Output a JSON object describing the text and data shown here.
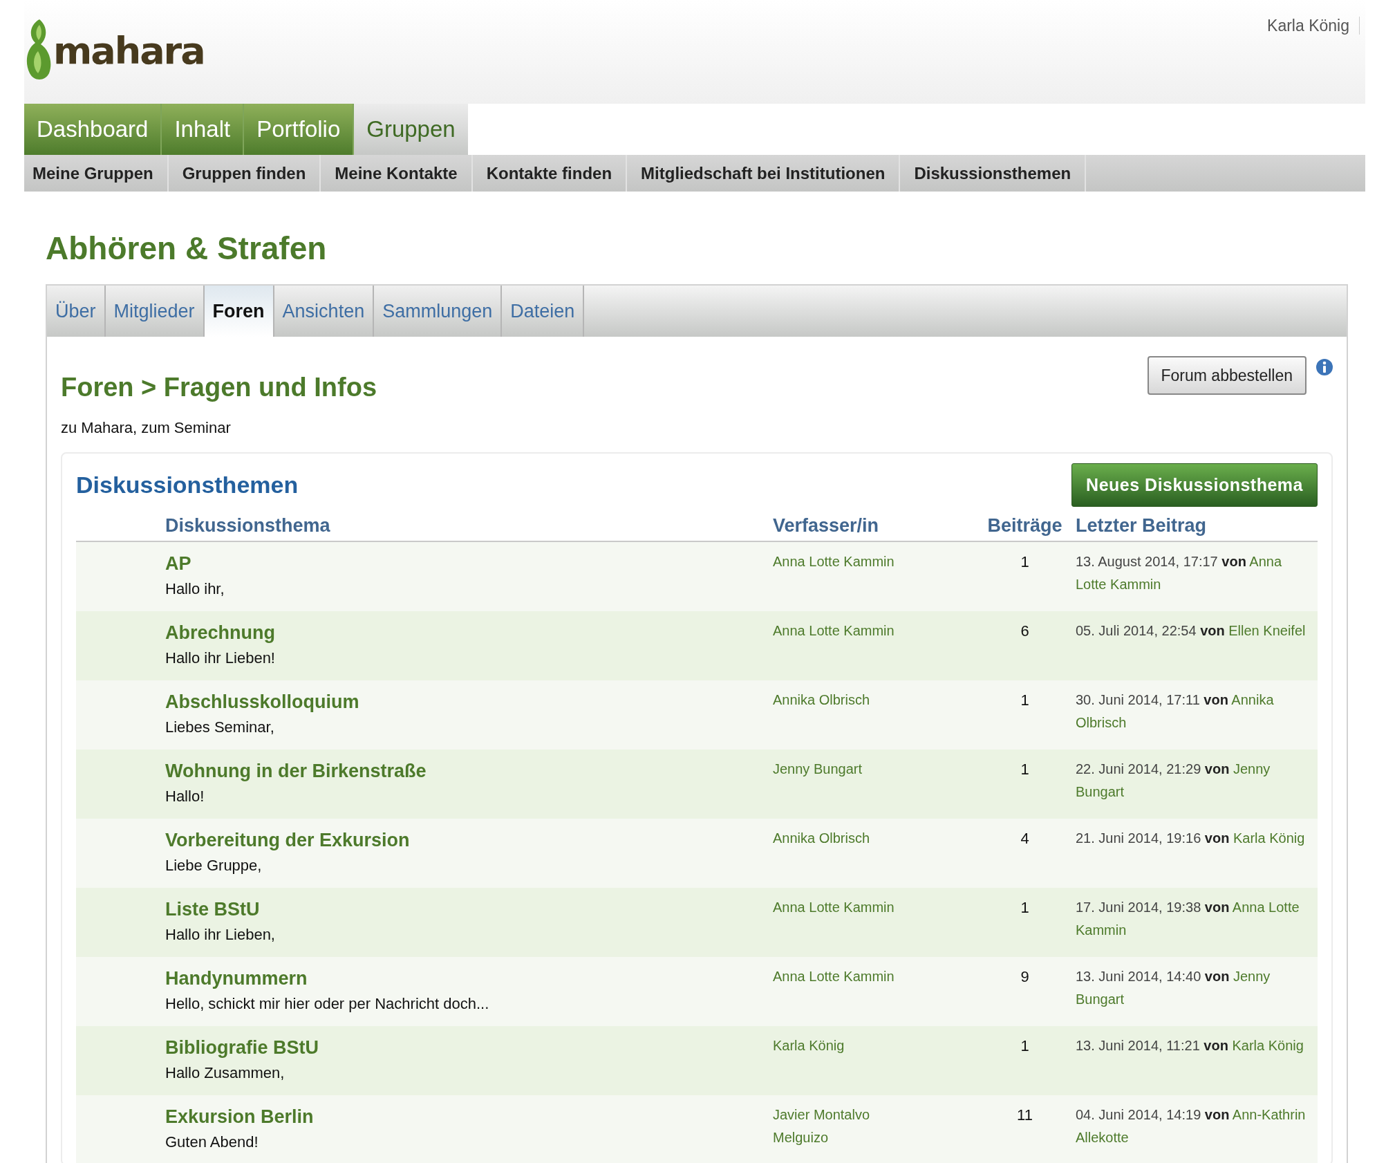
{
  "header": {
    "logo_text": "mahara",
    "user": "Karla König"
  },
  "main_nav": [
    {
      "label": "Dashboard",
      "selected": false
    },
    {
      "label": "Inhalt",
      "selected": false
    },
    {
      "label": "Portfolio",
      "selected": false
    },
    {
      "label": "Gruppen",
      "selected": true
    }
  ],
  "sub_nav": [
    "Meine Gruppen",
    "Gruppen finden",
    "Meine Kontakte",
    "Kontakte finden",
    "Mitgliedschaft bei Institutionen",
    "Diskussionsthemen"
  ],
  "group": {
    "title": "Abhören & Strafen",
    "tabs": [
      {
        "label": "Über",
        "selected": false
      },
      {
        "label": "Mitglieder",
        "selected": false
      },
      {
        "label": "Foren",
        "selected": true
      },
      {
        "label": "Ansichten",
        "selected": false
      },
      {
        "label": "Sammlungen",
        "selected": false
      },
      {
        "label": "Dateien",
        "selected": false
      }
    ]
  },
  "forum": {
    "heading": "Foren > Fragen und Infos",
    "description": "zu Mahara, zum Seminar",
    "unsubscribe_button": "Forum abbestellen"
  },
  "topics": {
    "heading": "Diskussionsthemen",
    "new_button": "Neues Diskussionsthema",
    "columns": [
      "Diskussionsthema",
      "Verfasser/in",
      "Beiträge",
      "Letzter Beitrag"
    ],
    "rows": [
      {
        "title": "AP",
        "excerpt": "Hallo ihr,",
        "author": "Anna Lotte Kammin",
        "posts": "1",
        "last_date": "13. August 2014, 17:17",
        "last_by": "von",
        "last_author": "Anna Lotte Kammin"
      },
      {
        "title": "Abrechnung",
        "excerpt": "Hallo ihr Lieben!",
        "author": "Anna Lotte Kammin",
        "posts": "6",
        "last_date": "05. Juli 2014, 22:54",
        "last_by": "von",
        "last_author": "Ellen Kneifel"
      },
      {
        "title": "Abschlusskolloquium",
        "excerpt": "Liebes Seminar,",
        "author": "Annika Olbrisch",
        "posts": "1",
        "last_date": "30. Juni 2014, 17:11",
        "last_by": "von",
        "last_author": "Annika Olbrisch"
      },
      {
        "title": "Wohnung in der Birkenstraße",
        "excerpt": "Hallo!",
        "author": "Jenny Bungart",
        "posts": "1",
        "last_date": "22. Juni 2014, 21:29",
        "last_by": "von",
        "last_author": "Jenny Bungart"
      },
      {
        "title": "Vorbereitung der Exkursion",
        "excerpt": "Liebe Gruppe,",
        "author": "Annika Olbrisch",
        "posts": "4",
        "last_date": "21. Juni 2014, 19:16",
        "last_by": "von",
        "last_author": "Karla König"
      },
      {
        "title": "Liste BStU",
        "excerpt": "Hallo ihr Lieben,",
        "author": "Anna Lotte Kammin",
        "posts": "1",
        "last_date": "17. Juni 2014, 19:38",
        "last_by": "von",
        "last_author": "Anna Lotte Kammin"
      },
      {
        "title": "Handynummern",
        "excerpt": "Hello, schickt mir hier oder per Nachricht doch...",
        "author": "Anna Lotte Kammin",
        "posts": "9",
        "last_date": "13. Juni 2014, 14:40",
        "last_by": "von",
        "last_author": "Jenny Bungart"
      },
      {
        "title": "Bibliografie BStU",
        "excerpt": "Hallo Zusammen,",
        "author": "Karla König",
        "posts": "1",
        "last_date": "13. Juni 2014, 11:21",
        "last_by": "von",
        "last_author": "Karla König"
      },
      {
        "title": "Exkursion Berlin",
        "excerpt": "Guten Abend!",
        "author": "Javier Montalvo Melguizo",
        "posts": "11",
        "last_date": "04. Juni 2014, 14:19",
        "last_by": "von",
        "last_author": "Ann-Kathrin Allekotte"
      }
    ]
  }
}
